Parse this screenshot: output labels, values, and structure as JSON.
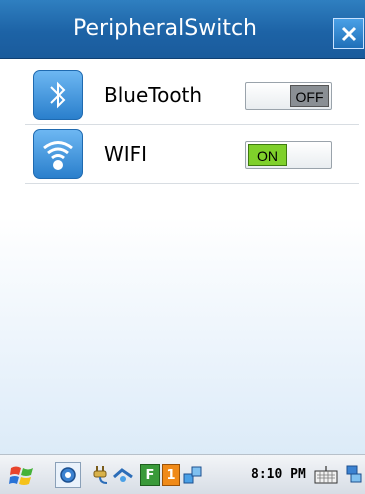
{
  "window": {
    "title": "PeripheralSwitch"
  },
  "rows": [
    {
      "label": "BlueTooth",
      "icon": "bluetooth-icon",
      "state": "OFF"
    },
    {
      "label": "WIFI",
      "icon": "wifi-icon",
      "state": "ON"
    }
  ],
  "taskbar": {
    "time": "8:10 PM",
    "badges": {
      "f": "F",
      "one": "1"
    }
  },
  "colors": {
    "titlebar": "#1d63a6",
    "toggle_on": "#7fd02b",
    "toggle_off": "#8a8f94"
  }
}
